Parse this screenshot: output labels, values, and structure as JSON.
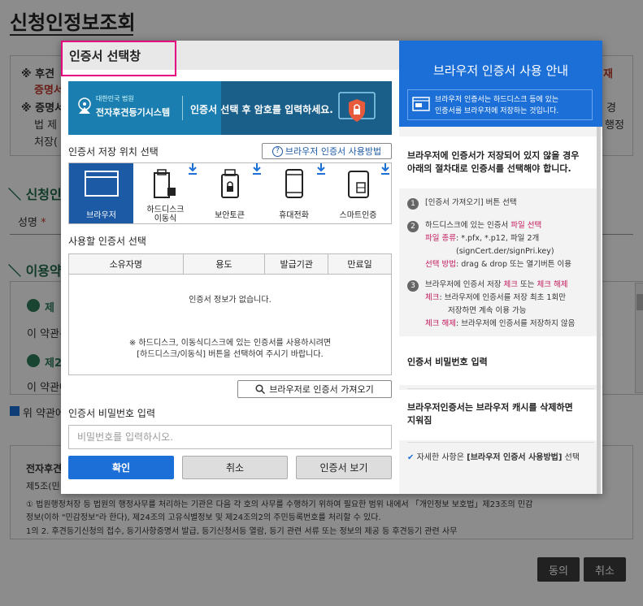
{
  "background": {
    "page_title": "신청인정보조회",
    "notice": [
      {
        "mark": "※ 후견",
        "tail": "재",
        "tail_red": true
      },
      {
        "text": "증명서",
        "red": true
      },
      {
        "mark": "※ 증명서",
        "tail": "경"
      },
      {
        "text": "법 제",
        "tail": "행정"
      },
      {
        "text": "처장("
      }
    ],
    "section_applicant": "신청인",
    "field_name_label": "성명",
    "required_mark": "*",
    "section_terms": "이용약",
    "term1": "제",
    "term_body1": "이 약관은",
    "term2": "제2",
    "term_body2": "이 약관에",
    "agree_text": "위 약관에",
    "bottom_title": "전자후견",
    "bottom_lines": [
      "제5조(민",
      "① 법원행정처장 등 법원의 행정사무를 처리하는 기관은 다음 각 호의 사무를 수행하기 위하여 필요한 범위 내에서 「개인정보 보호법」제23조의 민감",
      "정보(이하 \"민감정보\"라 한다), 제24조의 고유식별정보 및 제24조의2의 주민등록번호를 처리할 수 있다.",
      "1의 2. 후견등기신청의 접수, 등기사항증명서 발급, 등기신청서등 열람, 등기 관련 서류 또는 정보의 제공 등 후견등기 관련 사무"
    ],
    "agree_button": "동의",
    "cancel_button": "취소"
  },
  "modal": {
    "title": "인증서 선택창",
    "banner": {
      "org_small": "대한민국 법원",
      "org_name": "전자후견등기시스템",
      "message": "인증서 선택 후 암호를 입력하세요."
    },
    "location_label": "인증서 저장 위치 선택",
    "help_button": "브라우저 인증서 사용방법",
    "help_icon": "?",
    "locations": [
      {
        "label": "브라우저",
        "icon": "browser-icon",
        "selected": true
      },
      {
        "label": "하드디스크\n이동식",
        "icon": "usb-drive-icon",
        "selected": false
      },
      {
        "label": "보안토큰",
        "icon": "security-token-icon",
        "selected": false
      },
      {
        "label": "휴대전화",
        "icon": "mobile-phone-icon",
        "selected": false
      },
      {
        "label": "스마트인증",
        "icon": "smart-card-icon",
        "selected": false
      }
    ],
    "cert_select_label": "사용할 인증서 선택",
    "table_headers": [
      "소유자명",
      "용도",
      "발급기관",
      "만료일"
    ],
    "empty_message": "인증서 정보가 없습니다.",
    "empty_hint_line1": "※ 하드디스크, 이동식디스크에 있는 인증서를 사용하시려면",
    "empty_hint_line2": "[하드디스크/이동식] 버튼을 선택하여 주시기 바랍니다.",
    "import_button": "브라우저로 인증서 가져오기",
    "password_label": "인증서 비밀번호 입력",
    "password_placeholder": "비밀번호를 입력하시오.",
    "confirm_button": "확인",
    "cancel_button": "취소",
    "view_button": "인증서 보기",
    "colors": {
      "primary": "#1c6fd6",
      "highlight": "#e4007f"
    }
  },
  "guide": {
    "title": "브라우저 인증서 사용 안내",
    "header_line1": "브라우저 인증서는 하드디스크 등에 있는",
    "header_line2": "인증서를 브라우저에 저장하는 것입니다.",
    "intro_line1": "브라우저에 인증서가 저장되어 있지 않을 경우",
    "intro_line2": "아래의 절차대로 인증서를 선택해야 합니다.",
    "step1": {
      "num": "1",
      "text": "[인증서 가져오기] 버튼 선택"
    },
    "step2": {
      "num": "2",
      "line1a": "하드디스크에 있는 인증서 ",
      "line1b": "파일 선택",
      "line2a": "파일 종류",
      "line2b": ": *.pfx, *.p12, 파일 2개",
      "line3": "(signCert.der/signPri.key)",
      "line4a": "선택 방법",
      "line4b": ": drag & drop 또는 열기버튼 이용"
    },
    "step3": {
      "num": "3",
      "line1a": "브라우저에 인증서 저장 ",
      "line1b": "체크",
      "line1c": " 또는 ",
      "line1d": "체크 해제",
      "line2a": "체크",
      "line2b": ": 브라우저에 인증서를 저장 최초 1회만",
      "line3": "저장하면 계속 이용 가능",
      "line4a": "체크 해제",
      "line4b": ": 브라우저에 인증서를 저장하지 않음"
    },
    "password_title": "인증서 비밀번호 입력",
    "cache_line1": "브라우저인증서는 브라우저 캐시를 삭제하면",
    "cache_line2": "지워짐",
    "footer_a": "자세한 사항은 ",
    "footer_b": "[브라우저 인증서 사용방법]",
    "footer_c": " 선택"
  }
}
